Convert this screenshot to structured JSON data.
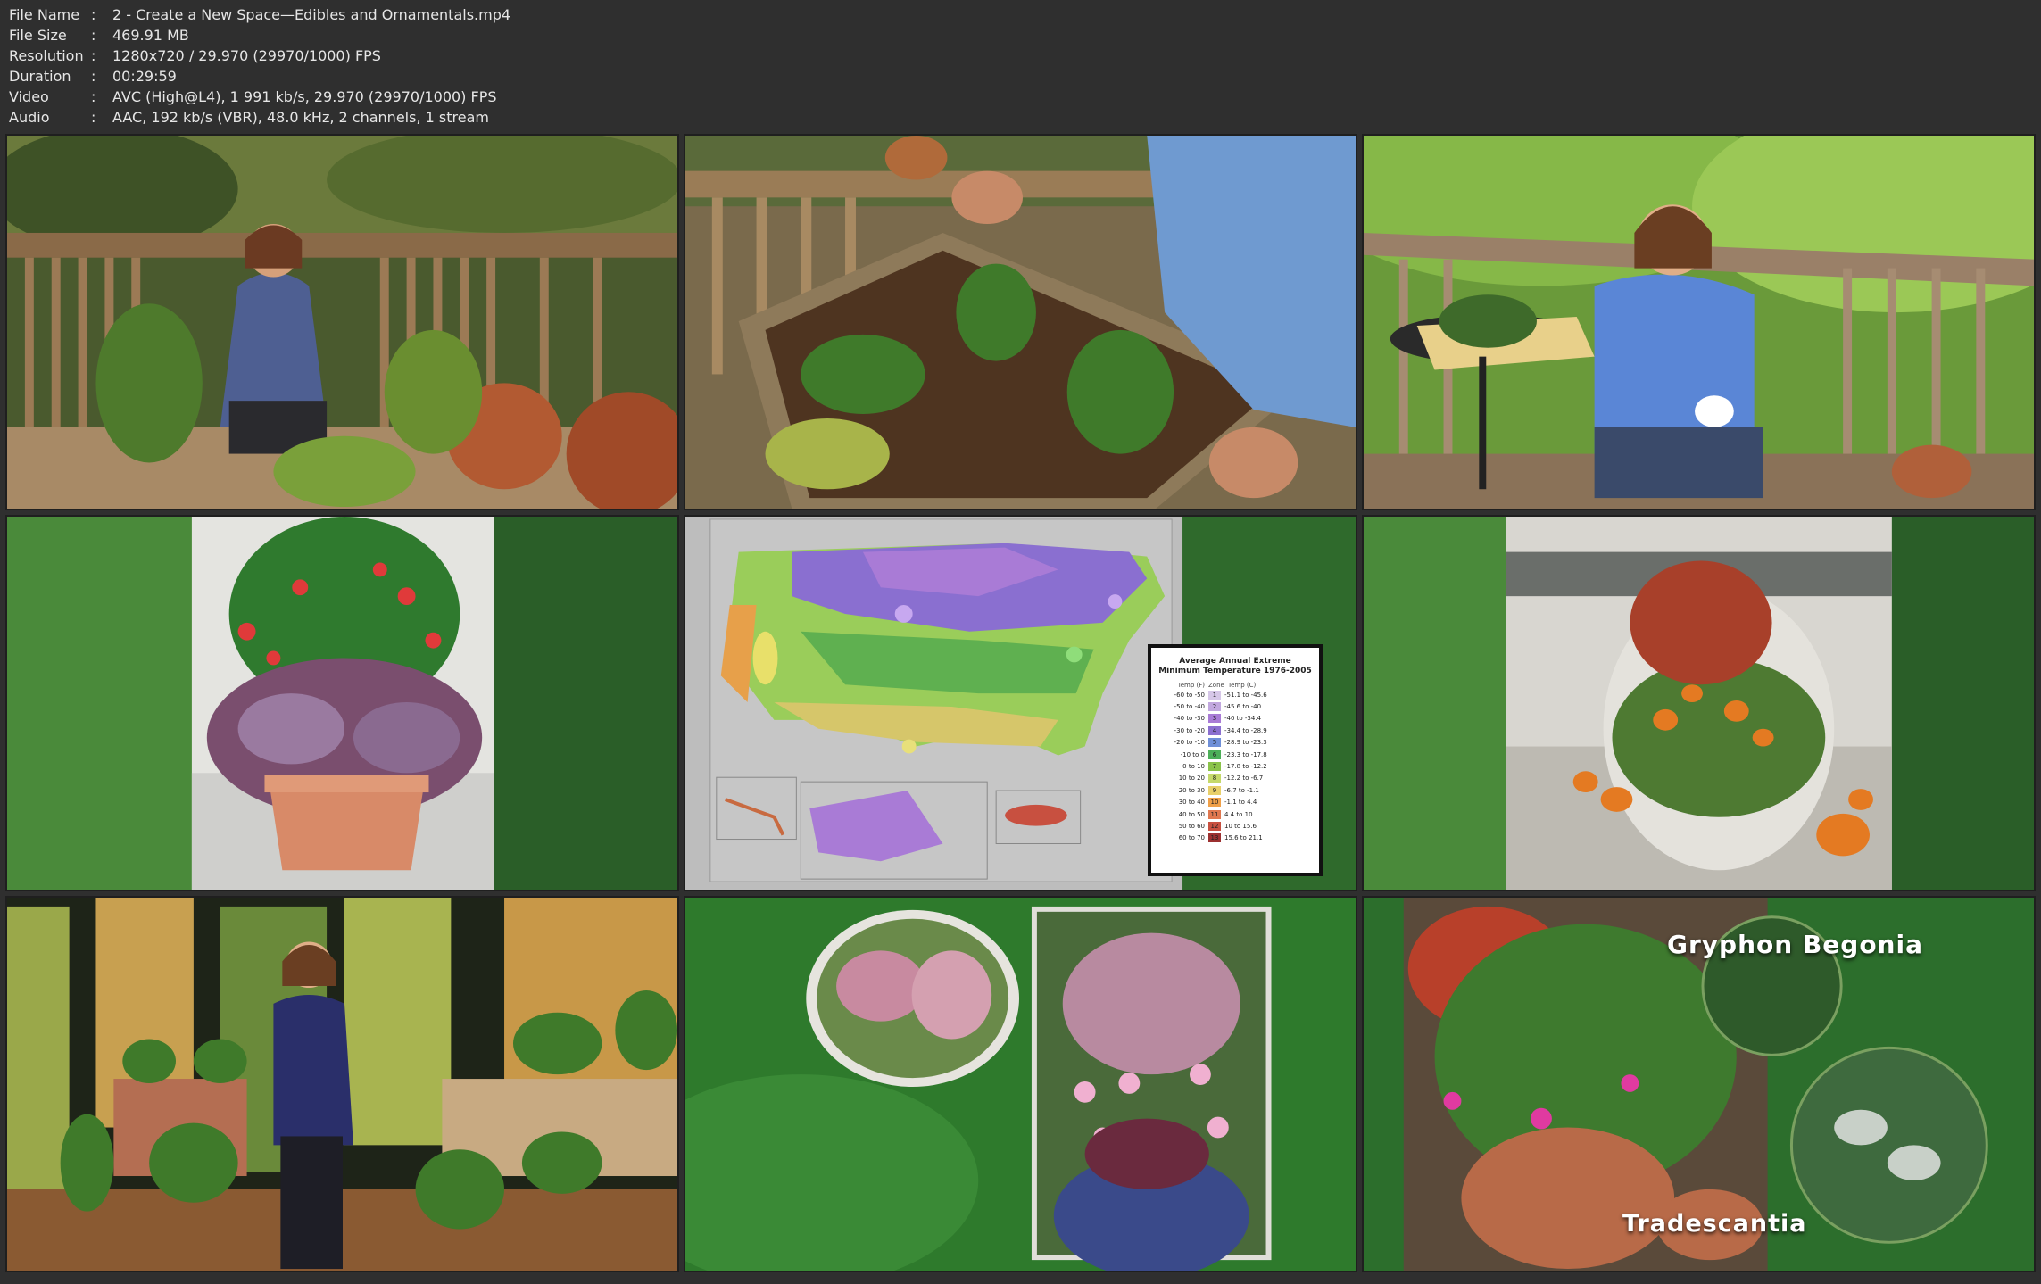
{
  "info": [
    {
      "key": "File Name",
      "value": "2 - Create a New Space—Edibles and Ornamentals.mp4"
    },
    {
      "key": "File Size",
      "value": "469.91 MB"
    },
    {
      "key": "Resolution",
      "value": "1280x720 / 29.970 (29970/1000) FPS"
    },
    {
      "key": "Duration",
      "value": "00:29:59"
    },
    {
      "key": "Video",
      "value": "AVC (High@L4), 1 991 kb/s, 29.970 (29970/1000) FPS"
    },
    {
      "key": "Audio",
      "value": "AAC, 192 kb/s (VBR), 48.0 kHz, 2 channels, 1 stream"
    }
  ],
  "legend": {
    "title": "Average Annual Extreme Minimum Temperature 1976-2005",
    "col_f": "Temp (F)",
    "col_zone": "Zone",
    "col_c": "Temp (C)",
    "rows": [
      {
        "f": "-60 to -50",
        "zone": "1",
        "c": "-51.1 to -45.6",
        "color": "#d6c7e8"
      },
      {
        "f": "-50 to -40",
        "zone": "2",
        "c": "-45.6 to -40",
        "color": "#c2a8df"
      },
      {
        "f": "-40 to -30",
        "zone": "3",
        "c": "-40 to -34.4",
        "color": "#a97bd6"
      },
      {
        "f": "-30 to -20",
        "zone": "4",
        "c": "-34.4 to -28.9",
        "color": "#8b6fd0"
      },
      {
        "f": "-20 to -10",
        "zone": "5",
        "c": "-28.9 to -23.3",
        "color": "#6f8fd8"
      },
      {
        "f": "-10 to 0",
        "zone": "6",
        "c": "-23.3 to -17.8",
        "color": "#4caf58"
      },
      {
        "f": "0 to 10",
        "zone": "7",
        "c": "-17.8 to -12.2",
        "color": "#8bc34a"
      },
      {
        "f": "10 to 20",
        "zone": "8",
        "c": "-12.2 to -6.7",
        "color": "#c5d96a"
      },
      {
        "f": "20 to 30",
        "zone": "9",
        "c": "-6.7 to -1.1",
        "color": "#e8d06a"
      },
      {
        "f": "30 to 40",
        "zone": "10",
        "c": "-1.1 to 4.4",
        "color": "#f0a048"
      },
      {
        "f": "40 to 50",
        "zone": "11",
        "c": "4.4 to 10",
        "color": "#e07850"
      },
      {
        "f": "50 to 60",
        "zone": "12",
        "c": "10 to 15.6",
        "color": "#c85040"
      },
      {
        "f": "60 to 70",
        "zone": "13",
        "c": "15.6 to 21.1",
        "color": "#9c3030"
      }
    ]
  },
  "labels": {
    "begonia": "Gryphon Begonia",
    "tradescantia": "Tradescantia"
  }
}
